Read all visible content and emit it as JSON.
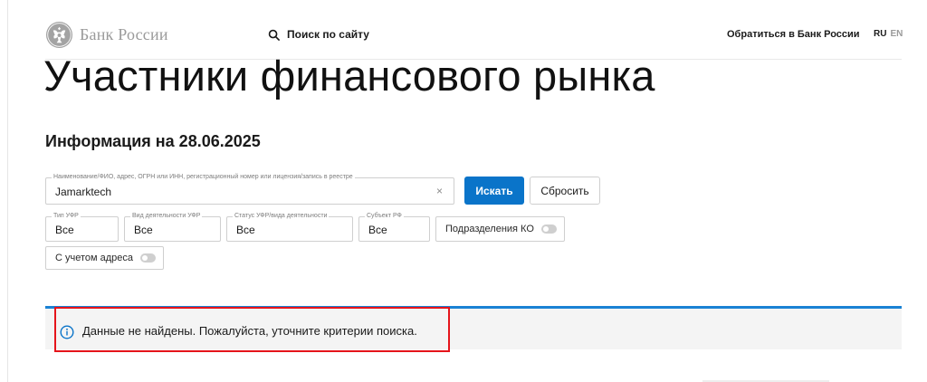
{
  "header": {
    "logo_text": "Банк России",
    "search_label": "Поиск по сайту",
    "contact_label": "Обратиться в Банк России",
    "lang_ru": "RU",
    "lang_en": "EN"
  },
  "page": {
    "title": "Участники финансового рынка",
    "info_date": "Информация на 28.06.2025"
  },
  "search_form": {
    "name_field": {
      "legend": "Наименование/ФИО, адрес, ОГРН или ИНН, регистрационный номер или лицензия/запись в реестре",
      "value": "Jamarktech",
      "clear_symbol": "×"
    },
    "search_button": "Искать",
    "reset_button": "Сбросить",
    "filters": [
      {
        "legend": "Тип УФР",
        "value": "Все"
      },
      {
        "legend": "Вид деятельности УФР",
        "value": "Все"
      },
      {
        "legend": "Статус УФР/вида деятельности",
        "value": "Все"
      },
      {
        "legend": "Субъект РФ",
        "value": "Все"
      }
    ],
    "branches_toggle": {
      "label": "Подразделения КО",
      "on": false
    },
    "address_toggle": {
      "label": "С учетом адреса",
      "on": false
    }
  },
  "result": {
    "message": "Данные не найдены. Пожалуйста, уточните критерии поиска.",
    "icon": "info-icon"
  },
  "colors": {
    "accent": "#0a74c9",
    "divider": "#1a82d4",
    "highlight": "#e5141b",
    "panel": "#f4f4f4"
  }
}
